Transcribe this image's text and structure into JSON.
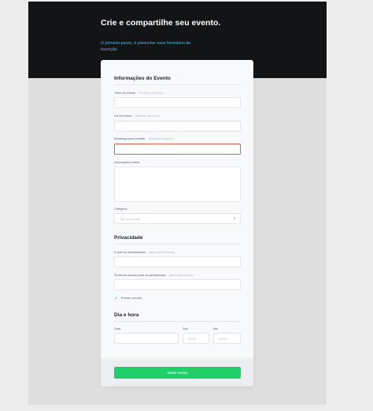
{
  "hero": {
    "title": "Crie e compartilhe seu evento.",
    "subtitle": "O primeiro passo, é preencher esse formulário de inscrição."
  },
  "event_info": {
    "title": "Informações do Evento",
    "fields": {
      "title": {
        "label": "Título do evento",
        "hint": "(Exibir o nome/url)"
      },
      "url": {
        "label": "Url do evento",
        "hint": "(Mostrar em link.c)"
      },
      "whatsapp": {
        "label": "Whatsapp para contato",
        "hint": "(Somente número)"
      },
      "info": {
        "label": "Informações extras"
      },
      "category": {
        "label": "Categoria",
        "placeholder": "Tipo do evento"
      }
    }
  },
  "privacy": {
    "title": "Privacidade",
    "fields": {
      "admin_email": {
        "label": "E-mail do administrador",
        "hint": "(Após enviar email)"
      },
      "password": {
        "label": "Senha de acesso para os participantes",
        "hint": "(Senha do evento)"
      }
    },
    "private_event_label": "Evento privado"
  },
  "datetime": {
    "title": "Dia e hora",
    "date_label": "Data",
    "time_label": "Das",
    "time_placeholder": "00:00",
    "until_label": "Até",
    "until_placeholder": "00:00"
  },
  "submit_label": "Salvar evento",
  "colors": {
    "accent": "#1fd06a",
    "hero_bg": "#121416",
    "hero_subtitle": "#3fc0f0",
    "error": "#e85a4f"
  }
}
